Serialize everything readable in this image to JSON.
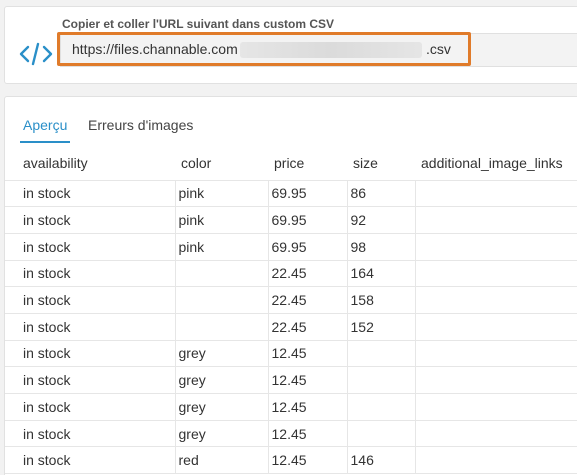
{
  "export": {
    "label": "Copier et coller l'URL suivant dans custom CSV",
    "url_prefix": "https://files.channable.com",
    "url_suffix": ".csv",
    "icon": "code-icon",
    "accent_color": "#2a8fc8",
    "highlight_color": "#e07b2a"
  },
  "tabs": [
    {
      "label": "Aperçu",
      "active": true
    },
    {
      "label": "Erreurs d'images",
      "active": false
    }
  ],
  "table": {
    "columns": [
      "availability",
      "color",
      "price",
      "size",
      "additional_image_links"
    ],
    "rows": [
      [
        "in stock",
        "pink",
        "69.95",
        "86",
        ""
      ],
      [
        "in stock",
        "pink",
        "69.95",
        "92",
        ""
      ],
      [
        "in stock",
        "pink",
        "69.95",
        "98",
        ""
      ],
      [
        "in stock",
        "",
        "22.45",
        "164",
        ""
      ],
      [
        "in stock",
        "",
        "22.45",
        "158",
        ""
      ],
      [
        "in stock",
        "",
        "22.45",
        "152",
        ""
      ],
      [
        "in stock",
        "grey",
        "12.45",
        "",
        ""
      ],
      [
        "in stock",
        "grey",
        "12.45",
        "",
        ""
      ],
      [
        "in stock",
        "grey",
        "12.45",
        "",
        ""
      ],
      [
        "in stock",
        "grey",
        "12.45",
        "",
        ""
      ],
      [
        "in stock",
        "red",
        "12.45",
        "146",
        ""
      ]
    ]
  }
}
